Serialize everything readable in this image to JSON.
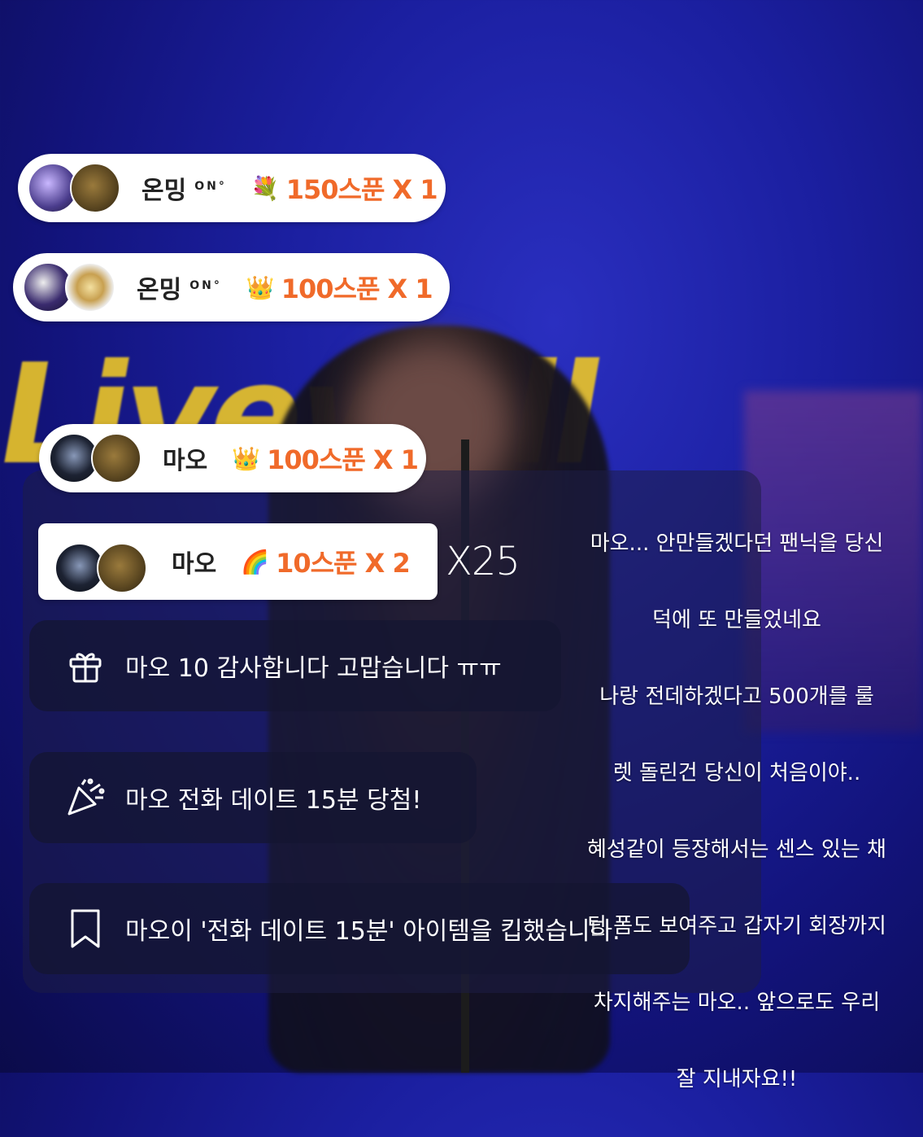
{
  "background_text": "Livewall",
  "gifts": [
    {
      "nick": "온밍",
      "nick_sub": "ON°",
      "icon": "flower-bouquet-icon",
      "amount": "150스푼 X 1"
    },
    {
      "nick": "온밍",
      "nick_sub": "ON°",
      "icon": "crown-icon",
      "amount": "100스푼 X 1"
    },
    {
      "nick": "마오",
      "nick_sub": "",
      "icon": "crown-icon",
      "amount": "100스푼 X 1"
    },
    {
      "nick": "마오",
      "nick_sub": "",
      "icon": "rainbow-icon",
      "amount": "10스푼 X 2"
    }
  ],
  "multiplier": "X25",
  "chat": [
    {
      "icon": "gift-icon",
      "text": "마오 10 감사합니다 고맙습니다 ㅠㅠ"
    },
    {
      "icon": "party-popper-icon",
      "text": "마오 전화 데이트 15분 당첨!"
    },
    {
      "icon": "bookmark-icon",
      "text": "마오이 '전화 데이트 15분' 아이템을 킵했습니다."
    }
  ],
  "memo_lines": [
    "마오... 안만들겠다던 팬닉을 당신",
    "덕에 또 만들었네요",
    "나랑 전데하겠다고 500개를 룰",
    "렛 돌린건 당신이 처음이야..",
    "혜성같이 등장해서는 센스 있는 채",
    "팅 폼도 보여주고 갑자기 회장까지",
    "차지해주는 마오.. 앞으로도 우리",
    "잘 지내자요!!"
  ],
  "colors": {
    "amount": "#f06a2a",
    "sign": "#e7c22a",
    "bg": "#1b1fa0"
  }
}
